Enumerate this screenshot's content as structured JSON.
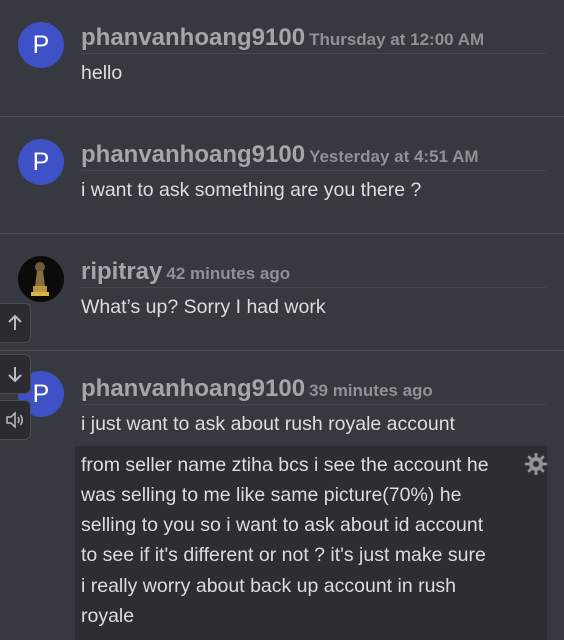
{
  "messages": [
    {
      "avatar_letter": "P",
      "username": "phanvanhoang9100",
      "timestamp": "Thursday at 12:00 AM",
      "lines": [
        "hello"
      ]
    },
    {
      "avatar_letter": "P",
      "username": "phanvanhoang9100",
      "timestamp": "Yesterday at 4:51 AM",
      "lines": [
        "i want to ask something are you there ?"
      ]
    },
    {
      "avatar_letter": "",
      "username": "ripitray",
      "timestamp": "42 minutes ago",
      "lines": [
        "What’s up? Sorry I had work"
      ]
    },
    {
      "avatar_letter": "P",
      "username": "phanvanhoang9100",
      "timestamp": "39 minutes ago",
      "lines": [
        "i just want to ask about rush royale account",
        "from seller name ztiha bcs i see the account he",
        "was selling to me like same picture(70%) he",
        "selling to you so i want to ask about id account",
        "to see if it's different or not ? it's just make sure",
        "i really worry about back up account in rush",
        "royale"
      ]
    }
  ],
  "icons": {
    "scroll_up": "arrow-up-icon",
    "scroll_down": "arrow-down-icon",
    "audio": "speaker-icon",
    "settings": "gear-icon"
  }
}
